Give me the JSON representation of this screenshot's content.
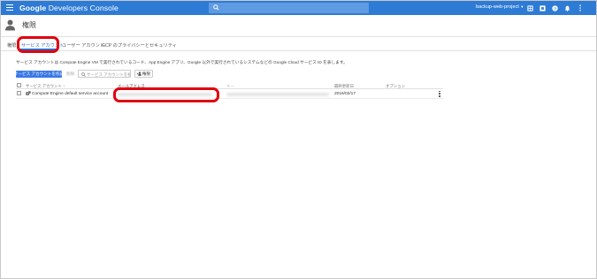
{
  "topbar": {
    "app_brand": "Google",
    "app_name": "Developers Console",
    "search_placeholder": "",
    "project_name": "backup-web-project",
    "icons": [
      "menu-icon",
      "search-icon",
      "dropdown-arrow-icon",
      "apps-icon",
      "support-icon",
      "help-icon",
      "notifications-icon",
      "more-vert-icon"
    ]
  },
  "page": {
    "title": "権限"
  },
  "tabs": [
    {
      "label": "権限"
    },
    {
      "label": "サービス アカウント",
      "active": true
    },
    {
      "label": "ユーザー アカウント"
    },
    {
      "label": "GCP のプライバシーとセキュリティ"
    }
  ],
  "description": "サービス アカウントは Compute Engine VM で実行されているコード、App Engine アプリ、Google 以外で実行されているシステムなどの Google Cloud サービス ID を表します。",
  "toolbar": {
    "create_label": "サービス アカウントを作成",
    "delete_label": "削除",
    "search_placeholder": "サービス アカウントを検索",
    "permissions_label": "権限"
  },
  "table": {
    "headers": {
      "name": "サービス アカウント",
      "sort_indicator": "↑",
      "email": "メールアドレス",
      "key": "キー",
      "date": "最終更新日",
      "options": "オプション"
    },
    "rows": [
      {
        "name": "Compute Engine default service account",
        "email": "",
        "key": "",
        "date": "2016/02/17"
      }
    ]
  },
  "colors": {
    "topbar": "#2e7bd5",
    "accent": "#3b78e7",
    "highlight": "#e00010"
  }
}
